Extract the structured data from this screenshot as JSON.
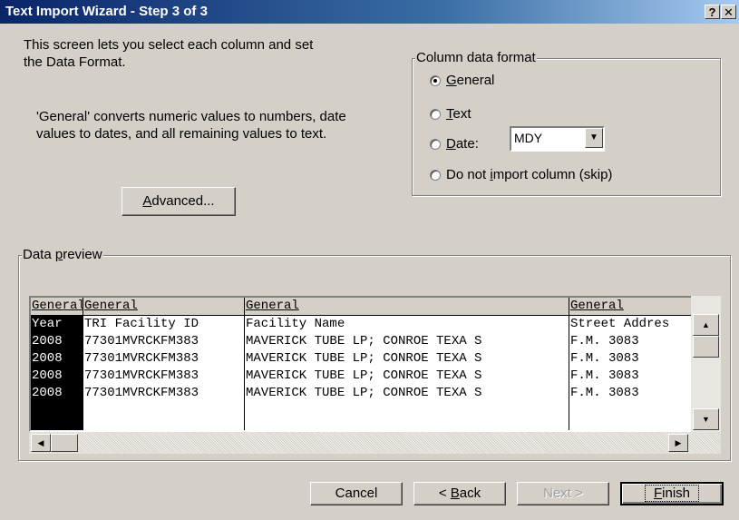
{
  "window": {
    "title": "Text Import Wizard - Step 3 of 3",
    "help_label": "?",
    "close_label": "✕"
  },
  "intro": {
    "line1": "This screen lets you select each column and set",
    "line2": "the Data Format.",
    "general_line1": "'General' converts numeric values to numbers, date",
    "general_line2": "values to dates, and all remaining values to text."
  },
  "advanced_button": {
    "pre": "",
    "accel": "A",
    "post": "dvanced..."
  },
  "column_format": {
    "legend": "Column data format",
    "options": [
      {
        "pre": "",
        "accel": "G",
        "post": "eneral",
        "checked": true
      },
      {
        "pre": "",
        "accel": "T",
        "post": "ext",
        "checked": false
      },
      {
        "pre": "",
        "accel": "D",
        "post": "ate:",
        "checked": false
      },
      {
        "pre": "Do not ",
        "accel": "i",
        "post": "mport column (skip)",
        "checked": false
      }
    ],
    "date_format": "MDY"
  },
  "preview": {
    "legend_pre": "Data ",
    "legend_accel": "p",
    "legend_post": "review",
    "headers": [
      "General",
      "General",
      "General",
      "General"
    ],
    "rows": [
      [
        "Year",
        "TRI Facility ID",
        "Facility Name",
        "Street Addres"
      ],
      [
        "2008",
        "77301MVRCKFM383",
        "MAVERICK TUBE LP; CONROE TEXA S",
        "F.M. 3083"
      ],
      [
        "2008",
        "77301MVRCKFM383",
        "MAVERICK TUBE LP; CONROE TEXA S",
        "F.M. 3083"
      ],
      [
        "2008",
        "77301MVRCKFM383",
        "MAVERICK TUBE LP; CONROE TEXA S",
        "F.M. 3083"
      ],
      [
        "2008",
        "77301MVRCKFM383",
        "MAVERICK TUBE LP; CONROE TEXA S",
        "F.M. 3083"
      ]
    ]
  },
  "buttons": {
    "cancel": "Cancel",
    "back_pre": "< ",
    "back_accel": "B",
    "back_post": "ack",
    "next": "Next >",
    "finish_accel": "F",
    "finish_post": "inish"
  }
}
